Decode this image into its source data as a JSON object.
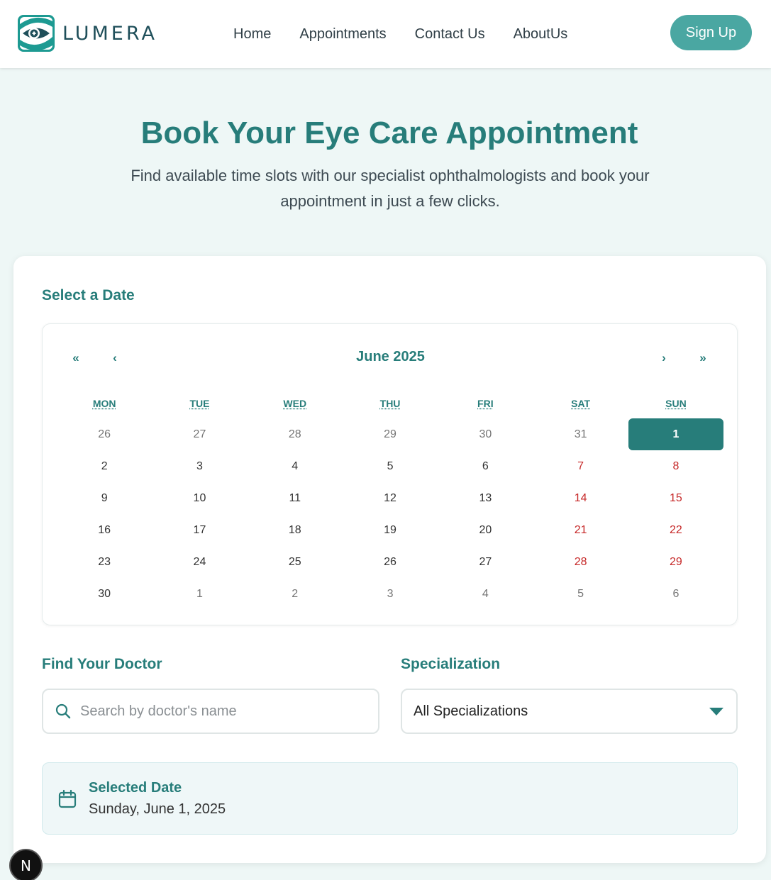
{
  "brand": {
    "name": "LUMERA",
    "logo_icon": "eye-logo-icon",
    "accent": "#277d7a",
    "button_color": "#4aa7a2"
  },
  "nav": {
    "items": [
      {
        "label": "Home"
      },
      {
        "label": "Appointments"
      },
      {
        "label": "Contact Us"
      },
      {
        "label": "AboutUs"
      }
    ],
    "signup_label": "Sign Up"
  },
  "hero": {
    "title": "Book Your Eye Care Appointment",
    "subtitle": "Find available time slots with our specialist ophthalmologists and book your appointment in just a few clicks."
  },
  "date_section": {
    "label": "Select a Date",
    "calendar": {
      "month_label": "June 2025",
      "nav": {
        "first": "«",
        "prev": "‹",
        "next": "›",
        "last": "»"
      },
      "weekdays": [
        "MON",
        "TUE",
        "WED",
        "THU",
        "FRI",
        "SAT",
        "SUN"
      ],
      "weeks": [
        [
          "26",
          "27",
          "28",
          "29",
          "30",
          "31",
          "1"
        ],
        [
          "2",
          "3",
          "4",
          "5",
          "6",
          "7",
          "8"
        ],
        [
          "9",
          "10",
          "11",
          "12",
          "13",
          "14",
          "15"
        ],
        [
          "16",
          "17",
          "18",
          "19",
          "20",
          "21",
          "22"
        ],
        [
          "23",
          "24",
          "25",
          "26",
          "27",
          "28",
          "29"
        ],
        [
          "30",
          "1",
          "2",
          "3",
          "4",
          "5",
          "6"
        ]
      ],
      "selected": "1",
      "weekend_color": "#c62828"
    }
  },
  "doctor_search": {
    "label": "Find Your Doctor",
    "placeholder": "Search by doctor's name",
    "value": "",
    "icon": "search-icon"
  },
  "specialization": {
    "label": "Specialization",
    "selected": "All Specializations",
    "icon": "caret-down-icon"
  },
  "selected_date": {
    "label": "Selected Date",
    "value": "Sunday, June 1, 2025",
    "icon": "calendar-icon"
  },
  "badge": {
    "letter": "N"
  }
}
